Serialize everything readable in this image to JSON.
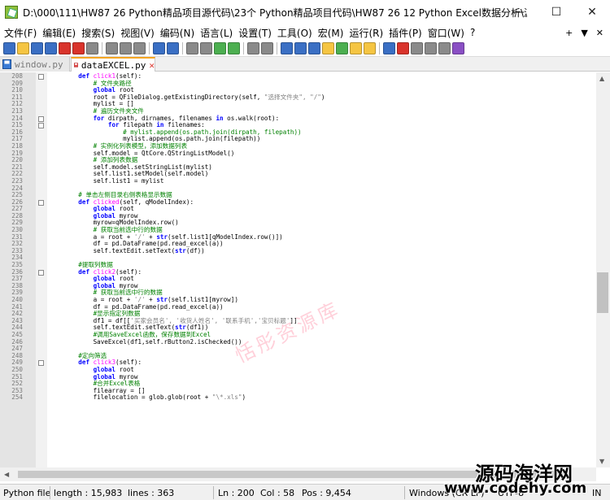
{
  "window": {
    "title": "D:\\000\\111\\HW87 26 Python精品项目源代码\\23个 Python精品项目代码\\HW87 26 12 Python Excel数据分析\\源程序\\...",
    "minimize": "—",
    "maximize": "☐",
    "close": "✕"
  },
  "menu": {
    "items": [
      "文件(F)",
      "编辑(E)",
      "搜索(S)",
      "视图(V)",
      "编码(N)",
      "语言(L)",
      "设置(T)",
      "工具(O)",
      "宏(M)",
      "运行(R)",
      "插件(P)",
      "窗口(W)",
      "?"
    ],
    "right_plus": "+",
    "right_arrow": "▼",
    "right_close": "✕"
  },
  "toolbar": {
    "icons": [
      "new-file-icon",
      "open-file-icon",
      "save-icon",
      "save-all-icon",
      "close-icon",
      "close-all-icon",
      "print-icon",
      "cut-icon",
      "copy-icon",
      "paste-icon",
      "undo-icon",
      "redo-icon",
      "find-icon",
      "replace-icon",
      "zoom-in-icon",
      "zoom-out-icon",
      "sync-v-icon",
      "sync-h-icon",
      "word-wrap-icon",
      "show-all-icon",
      "indent-guide-icon",
      "udl-icon",
      "doc-map-icon",
      "function-list-icon",
      "folder-workspace-icon",
      "monitor-icon",
      "record-macro-icon",
      "stop-macro-icon",
      "play-macro-icon",
      "play-multiple-icon",
      "save-macro-icon"
    ],
    "colors": {
      "blue": "#3a6fc4",
      "green": "#4caf50",
      "red": "#d9332b",
      "yellow": "#f5c542",
      "gray": "#8a8a8a",
      "purple": "#8a4fc4"
    }
  },
  "tabs": [
    {
      "label": "window.py",
      "active": false
    },
    {
      "label": "dataEXCEL.py",
      "active": true
    }
  ],
  "code": [
    {
      "n": "208",
      "fold": true,
      "t": [
        [
          "    ",
          "nm"
        ],
        [
          "def",
          "kw"
        ],
        [
          " ",
          "nm"
        ],
        [
          "click1",
          "fn"
        ],
        [
          "(self):",
          "nm"
        ]
      ]
    },
    {
      "n": "209",
      "t": [
        [
          "        ",
          "nm"
        ],
        [
          "# 文件夹路径",
          "cm"
        ]
      ]
    },
    {
      "n": "210",
      "t": [
        [
          "        ",
          "nm"
        ],
        [
          "global",
          "kw"
        ],
        [
          " root",
          "nm"
        ]
      ]
    },
    {
      "n": "211",
      "t": [
        [
          "        root = QFileDialog.getExistingDirectory(self, ",
          "nm"
        ],
        [
          "\"选择文件夹\", \"/\"",
          "st"
        ],
        [
          ")",
          "nm"
        ]
      ]
    },
    {
      "n": "212",
      "t": [
        [
          "        mylist = []",
          "nm"
        ]
      ]
    },
    {
      "n": "213",
      "t": [
        [
          "        ",
          "nm"
        ],
        [
          "# 遍历文件夹文件",
          "cm"
        ]
      ]
    },
    {
      "n": "214",
      "fold": true,
      "t": [
        [
          "        ",
          "nm"
        ],
        [
          "for",
          "kw"
        ],
        [
          " dirpath, dirnames, filenames ",
          "nm"
        ],
        [
          "in",
          "kw"
        ],
        [
          " os.walk(root):",
          "nm"
        ]
      ]
    },
    {
      "n": "215",
      "fold": true,
      "t": [
        [
          "            ",
          "nm"
        ],
        [
          "for",
          "kw"
        ],
        [
          " filepath ",
          "nm"
        ],
        [
          "in",
          "kw"
        ],
        [
          " filenames:",
          "nm"
        ]
      ]
    },
    {
      "n": "216",
      "t": [
        [
          "                ",
          "nm"
        ],
        [
          "# mylist.append(os.path.join(dirpath, filepath))",
          "cm"
        ]
      ]
    },
    {
      "n": "217",
      "t": [
        [
          "                mylist.append(os.path.join(filepath))",
          "nm"
        ]
      ]
    },
    {
      "n": "218",
      "t": [
        [
          "        ",
          "nm"
        ],
        [
          "# 实例化列表模型，添加数据列表",
          "cm"
        ]
      ]
    },
    {
      "n": "219",
      "t": [
        [
          "        self.model = QtCore.QStringListModel()",
          "nm"
        ]
      ]
    },
    {
      "n": "220",
      "t": [
        [
          "        ",
          "nm"
        ],
        [
          "# 添加列表数据",
          "cm"
        ]
      ]
    },
    {
      "n": "221",
      "t": [
        [
          "        self.model.setStringList(mylist)",
          "nm"
        ]
      ]
    },
    {
      "n": "222",
      "t": [
        [
          "        self.list1.setModel(self.model)",
          "nm"
        ]
      ]
    },
    {
      "n": "223",
      "t": [
        [
          "        self.list1 = mylist",
          "nm"
        ]
      ]
    },
    {
      "n": "224",
      "t": [
        [
          "",
          "nm"
        ]
      ]
    },
    {
      "n": "225",
      "t": [
        [
          "    ",
          "nm"
        ],
        [
          "# 单击左侧目录右侧表格显示数据",
          "cm"
        ]
      ]
    },
    {
      "n": "226",
      "fold": true,
      "t": [
        [
          "    ",
          "nm"
        ],
        [
          "def",
          "kw"
        ],
        [
          " ",
          "nm"
        ],
        [
          "clicked",
          "fn"
        ],
        [
          "(self, qModelIndex):",
          "nm"
        ]
      ]
    },
    {
      "n": "227",
      "t": [
        [
          "        ",
          "nm"
        ],
        [
          "global",
          "kw"
        ],
        [
          " root",
          "nm"
        ]
      ]
    },
    {
      "n": "228",
      "t": [
        [
          "        ",
          "nm"
        ],
        [
          "global",
          "kw"
        ],
        [
          " myrow",
          "nm"
        ]
      ]
    },
    {
      "n": "229",
      "t": [
        [
          "        myrow=qModelIndex.row()",
          "nm"
        ]
      ]
    },
    {
      "n": "230",
      "t": [
        [
          "        ",
          "nm"
        ],
        [
          "# 获取当前选中行的数据",
          "cm"
        ]
      ]
    },
    {
      "n": "231",
      "t": [
        [
          "        a = root + ",
          "nm"
        ],
        [
          "'/'",
          "st"
        ],
        [
          " + ",
          "nm"
        ],
        [
          "str",
          "kw"
        ],
        [
          "(self.list1[qModelIndex.row()])",
          "nm"
        ]
      ]
    },
    {
      "n": "232",
      "t": [
        [
          "        df = pd.DataFrame(pd.read_excel(a))",
          "nm"
        ]
      ]
    },
    {
      "n": "233",
      "t": [
        [
          "        self.textEdit.setText(",
          "nm"
        ],
        [
          "str",
          "kw"
        ],
        [
          "(df))",
          "nm"
        ]
      ]
    },
    {
      "n": "234",
      "t": [
        [
          "",
          "nm"
        ]
      ]
    },
    {
      "n": "235",
      "t": [
        [
          "    ",
          "nm"
        ],
        [
          "#提取列数据",
          "cm"
        ]
      ]
    },
    {
      "n": "236",
      "fold": true,
      "t": [
        [
          "    ",
          "nm"
        ],
        [
          "def",
          "kw"
        ],
        [
          " ",
          "nm"
        ],
        [
          "click2",
          "fn"
        ],
        [
          "(self):",
          "nm"
        ]
      ]
    },
    {
      "n": "237",
      "t": [
        [
          "        ",
          "nm"
        ],
        [
          "global",
          "kw"
        ],
        [
          " root",
          "nm"
        ]
      ]
    },
    {
      "n": "238",
      "t": [
        [
          "        ",
          "nm"
        ],
        [
          "global",
          "kw"
        ],
        [
          " myrow",
          "nm"
        ]
      ]
    },
    {
      "n": "239",
      "t": [
        [
          "        ",
          "nm"
        ],
        [
          "# 获取当前选中行的数据",
          "cm"
        ]
      ]
    },
    {
      "n": "240",
      "t": [
        [
          "        a = root + ",
          "nm"
        ],
        [
          "'/'",
          "st"
        ],
        [
          " + ",
          "nm"
        ],
        [
          "str",
          "kw"
        ],
        [
          "(self.list1[myrow])",
          "nm"
        ]
      ]
    },
    {
      "n": "241",
      "t": [
        [
          "        df = pd.DataFrame(pd.read_excel(a))",
          "nm"
        ]
      ]
    },
    {
      "n": "242",
      "t": [
        [
          "        ",
          "nm"
        ],
        [
          "#显示指定列数据",
          "cm"
        ]
      ]
    },
    {
      "n": "243",
      "t": [
        [
          "        df1 = df[[",
          "nm"
        ],
        [
          "'买家会员名', '收货人姓名', '联系手机','宝贝标题'",
          "st"
        ],
        [
          "]]",
          "nm"
        ]
      ]
    },
    {
      "n": "244",
      "t": [
        [
          "        self.textEdit.setText(",
          "nm"
        ],
        [
          "str",
          "kw"
        ],
        [
          "(df1))",
          "nm"
        ]
      ]
    },
    {
      "n": "245",
      "t": [
        [
          "        ",
          "nm"
        ],
        [
          "#调用SaveExcel函数，保存数据到Excel",
          "cm"
        ]
      ]
    },
    {
      "n": "246",
      "t": [
        [
          "        SaveExcel(df1,self.rButton2.isChecked())",
          "nm"
        ]
      ]
    },
    {
      "n": "247",
      "t": [
        [
          "",
          "nm"
        ]
      ]
    },
    {
      "n": "248",
      "t": [
        [
          "    ",
          "nm"
        ],
        [
          "#定向筛选",
          "cm"
        ]
      ]
    },
    {
      "n": "249",
      "fold": true,
      "t": [
        [
          "    ",
          "nm"
        ],
        [
          "def",
          "kw"
        ],
        [
          " ",
          "nm"
        ],
        [
          "click3",
          "fn"
        ],
        [
          "(self):",
          "nm"
        ]
      ]
    },
    {
      "n": "250",
      "t": [
        [
          "        ",
          "nm"
        ],
        [
          "global",
          "kw"
        ],
        [
          " root",
          "nm"
        ]
      ]
    },
    {
      "n": "251",
      "t": [
        [
          "        ",
          "nm"
        ],
        [
          "global",
          "kw"
        ],
        [
          " myrow",
          "nm"
        ]
      ]
    },
    {
      "n": "252",
      "t": [
        [
          "        ",
          "nm"
        ],
        [
          "#合并Excel表格",
          "cm"
        ]
      ]
    },
    {
      "n": "253",
      "t": [
        [
          "        filearray = []",
          "nm"
        ]
      ]
    },
    {
      "n": "254",
      "t": [
        [
          "        filelocation = glob.glob(root + ",
          "nm"
        ],
        [
          "\"\\*.xls\"",
          "st"
        ],
        [
          ")",
          "nm"
        ]
      ]
    }
  ],
  "watermark": "恬彤资源库",
  "status": {
    "file_type": "Python file",
    "length": "length : 15,983",
    "lines": "lines : 363",
    "ln": "Ln : 200",
    "col": "Col : 58",
    "pos": "Pos : 9,454",
    "eol": "Windows (CR LF)",
    "encoding": "UTF-8",
    "ins": "IN"
  },
  "site": {
    "cn_name": "源码海洋网",
    "url": "www.codehy.com"
  }
}
